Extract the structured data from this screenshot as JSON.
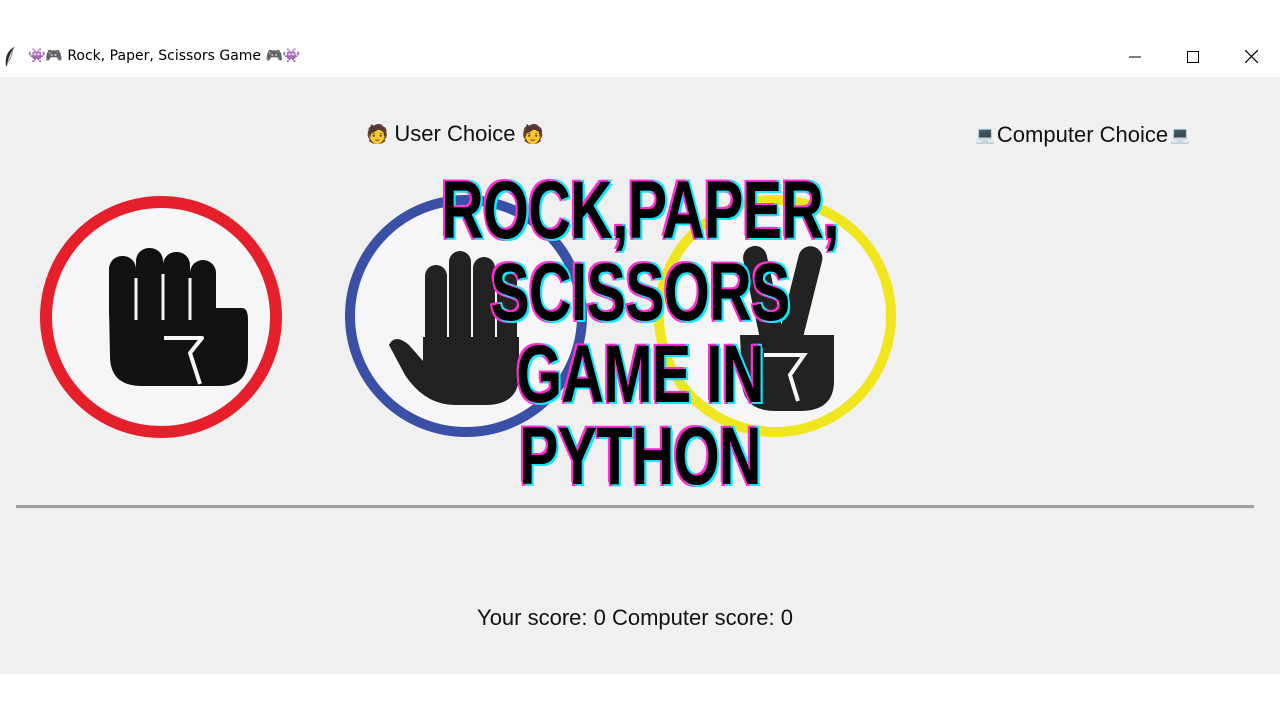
{
  "window": {
    "title": "👾🎮 Rock, Paper, Scissors Game 🎮👾",
    "app_icon": "feather-icon",
    "controls": [
      "minimize-icon",
      "maximize-icon",
      "close-icon"
    ]
  },
  "labels": {
    "user_choice": "User Choice",
    "user_emoji": "🧑",
    "computer_choice": "Computer Choice",
    "computer_emoji": "💻"
  },
  "choices": [
    {
      "name": "rock",
      "icon": "fist-icon",
      "ring_color": "#e6202b"
    },
    {
      "name": "paper",
      "icon": "open-hand-icon",
      "ring_color": "#3a4fa6"
    },
    {
      "name": "scissors",
      "icon": "peace-hand-icon",
      "ring_color": "#f0e61e"
    }
  ],
  "score": {
    "text": "Your score: 0 Computer score: 0"
  },
  "overlay": {
    "lines": [
      "ROCK,PAPER,",
      "SCISSORS",
      "GAME IN",
      "PYTHON"
    ],
    "fill": "#000000",
    "outline_colors": [
      "#ff2bd6",
      "#12e6ff"
    ]
  }
}
